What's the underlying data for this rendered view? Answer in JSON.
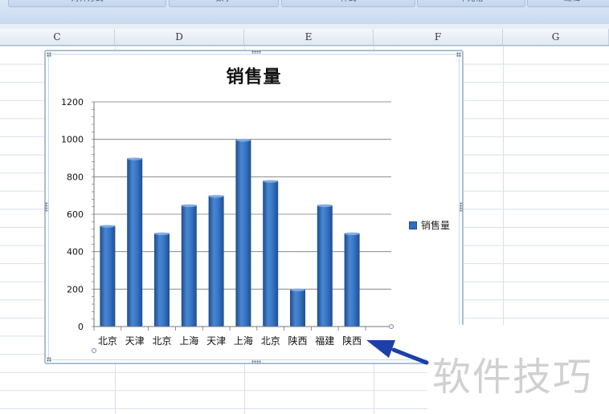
{
  "ribbon": {
    "groups": [
      "对齐方式",
      "数字",
      "样式",
      "单元格",
      "编辑"
    ]
  },
  "columns": [
    "C",
    "D",
    "E",
    "F",
    "G"
  ],
  "chart_data": {
    "type": "bar",
    "title": "销售量",
    "categories": [
      "北京",
      "天津",
      "北京",
      "上海",
      "天津",
      "上海",
      "北京",
      "陕西",
      "福建",
      "陕西"
    ],
    "series": [
      {
        "name": "销售量",
        "values": [
          540,
          900,
          500,
          650,
          700,
          1000,
          780,
          200,
          650,
          500
        ]
      }
    ],
    "ylim": [
      0,
      1200
    ],
    "yticks": [
      0,
      200,
      400,
      600,
      800,
      1000,
      1200
    ],
    "grid": true,
    "legend": "right",
    "colors": {
      "bar": "#2f6fbf",
      "bar_dark": "#1b4c8e",
      "bar_light": "#5e95d8"
    }
  },
  "watermark": {
    "text": "软件技巧"
  },
  "annotation": {
    "arrow_color": "#1d3fa8",
    "icon": "arrow-icon"
  }
}
